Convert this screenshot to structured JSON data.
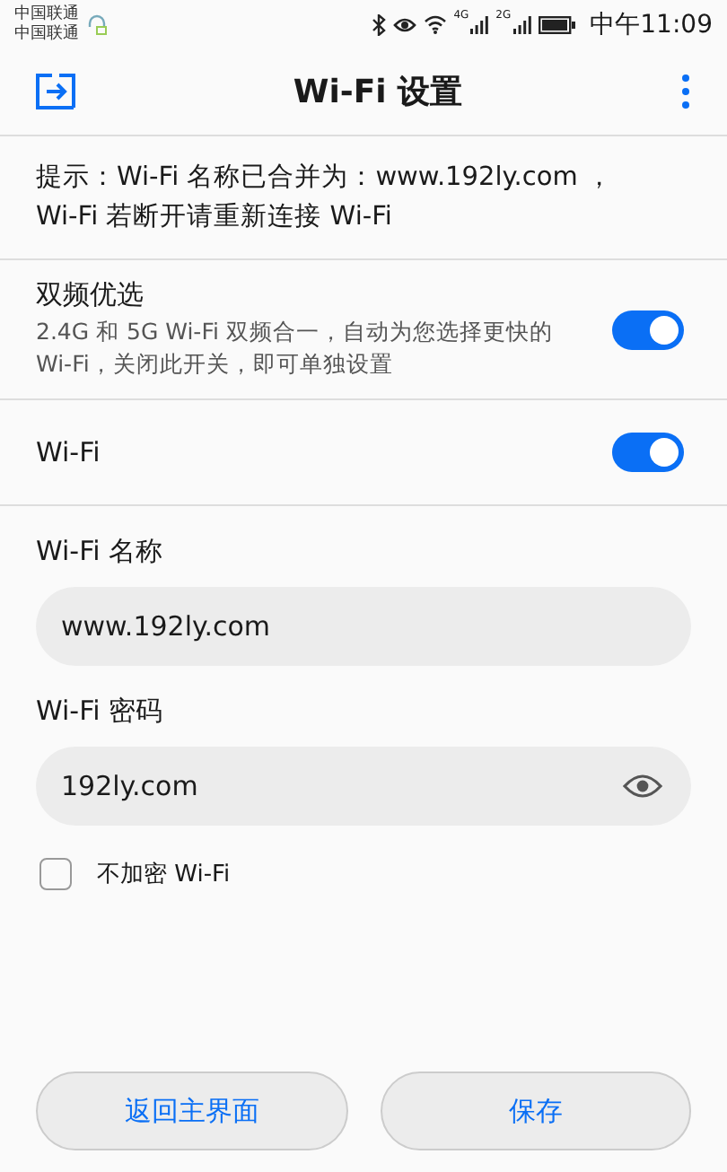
{
  "status_bar": {
    "carriers": [
      "中国联通",
      "中国联通"
    ],
    "network_labels": [
      "4G",
      "2G"
    ],
    "time": "中午11:09"
  },
  "header": {
    "title": "Wi-Fi 设置"
  },
  "notice": "提示：Wi-Fi 名称已合并为：www.192ly.com ，Wi-Fi 若断开请重新连接 Wi-Fi",
  "settings": [
    {
      "title": "双频优选",
      "description": "2.4G 和 5G Wi-Fi 双频合一，自动为您选择更快的 Wi-Fi，关闭此开关，即可单独设置",
      "on": true
    },
    {
      "title": "Wi-Fi",
      "on": true
    }
  ],
  "fields": [
    {
      "label": "Wi-Fi 名称",
      "value": "www.192ly.com",
      "kind": "text"
    },
    {
      "label": "Wi-Fi 密码",
      "value": "192ly.com",
      "kind": "password"
    }
  ],
  "no_encryption": {
    "label": "不加密 Wi-Fi",
    "checked": false
  },
  "buttons": [
    "返回主界面",
    "保存"
  ]
}
